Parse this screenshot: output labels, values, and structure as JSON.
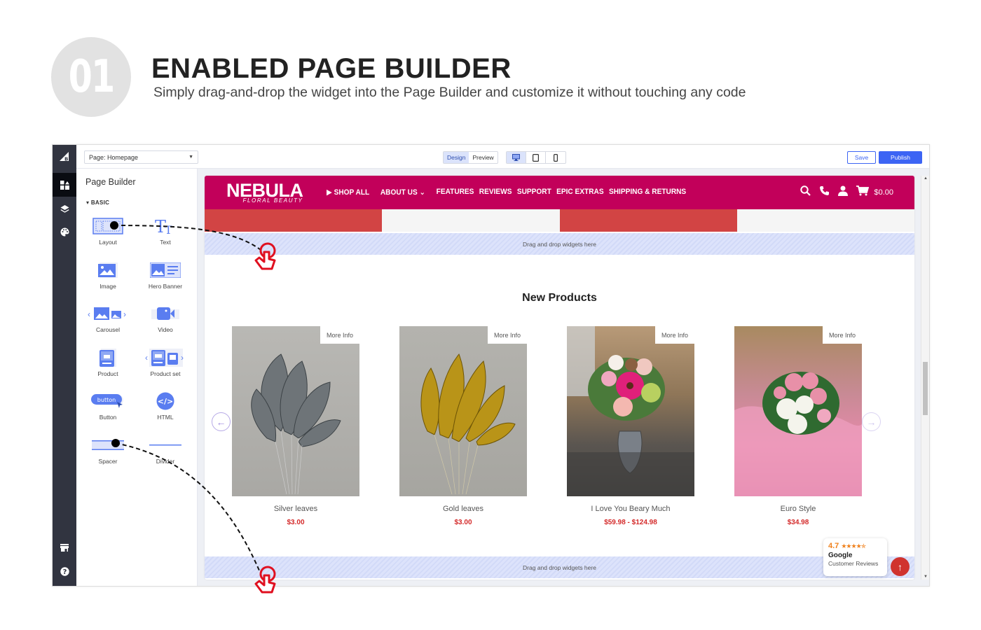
{
  "hero": {
    "number": "01",
    "title": "ENABLED PAGE BUILDER",
    "subtitle": "Simply drag-and-drop the widget into the Page Builder and customize it without touching any code"
  },
  "topbar": {
    "page_select": "Page: Homepage",
    "mode_tabs": [
      {
        "label": "Design",
        "active": true
      },
      {
        "label": "Preview",
        "active": false
      }
    ],
    "devices": [
      {
        "icon": "desktop-icon",
        "active": true
      },
      {
        "icon": "tablet-icon",
        "active": false
      },
      {
        "icon": "mobile-icon",
        "active": false
      }
    ],
    "save_label": "Save",
    "publish_label": "Publish",
    "accent": "#3c64f4"
  },
  "rail": {
    "items": [
      "bigcommerce-logo-icon",
      "widgets-icon",
      "layers-icon",
      "palette-icon",
      "storefront-icon",
      "help-icon"
    ]
  },
  "panel": {
    "title": "Page Builder",
    "section": "BASIC",
    "widgets": [
      {
        "label": "Layout",
        "icon": "layout-icon"
      },
      {
        "label": "Text",
        "icon": "text-icon"
      },
      {
        "label": "Image",
        "icon": "image-icon"
      },
      {
        "label": "Hero Banner",
        "icon": "hero-banner-icon"
      },
      {
        "label": "Carousel",
        "icon": "carousel-icon"
      },
      {
        "label": "Video",
        "icon": "video-icon"
      },
      {
        "label": "Product",
        "icon": "product-icon"
      },
      {
        "label": "Product set",
        "icon": "product-set-icon"
      },
      {
        "label": "Button",
        "icon": "button-icon",
        "icon_text": "button"
      },
      {
        "label": "HTML",
        "icon": "html-icon"
      },
      {
        "label": "Spacer",
        "icon": "spacer-icon"
      },
      {
        "label": "Divider",
        "icon": "divider-icon"
      }
    ]
  },
  "store": {
    "brand": "NEBULA",
    "brand_tagline": "FLORAL BEAUTY",
    "brand_color": "#c2005a",
    "nav": [
      "SHOP ALL",
      "ABOUT US",
      "FEATURES",
      "REVIEWS",
      "SUPPORT",
      "EPIC EXTRAS",
      "SHIPPING & RETURNS"
    ],
    "cart_total": "$0.00",
    "banner_colors": [
      "#d24444",
      "#f5f5f5",
      "#d24444",
      "#f5f5f5"
    ],
    "dropzone_text": "Drag and drop widgets here",
    "section_title": "New Products",
    "more_info_label": "More Info",
    "products": [
      {
        "name": "Silver leaves",
        "price": "$3.00"
      },
      {
        "name": "Gold leaves",
        "price": "$3.00"
      },
      {
        "name": "I Love You Beary Much",
        "price": "$59.98 - $124.98"
      },
      {
        "name": "Euro Style",
        "price": "$34.98"
      }
    ],
    "price_color": "#d42a2a",
    "review_badge": {
      "rating": "4.7",
      "stars": "★★★★✯",
      "source": "Google",
      "caption": "Customer Reviews"
    }
  }
}
